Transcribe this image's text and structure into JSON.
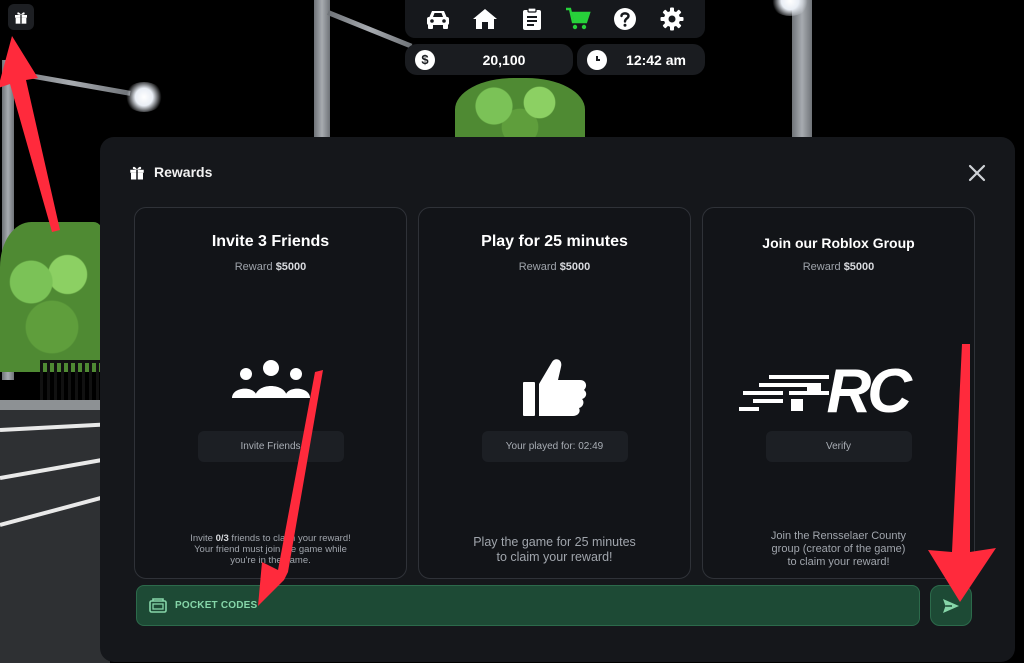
{
  "hud": {
    "gift_icon": "gift-icon",
    "toolbar_icons": [
      "car-icon",
      "home-icon",
      "clipboard-icon",
      "cart-icon",
      "help-icon",
      "settings-icon"
    ],
    "money_value": "20,100",
    "money_symbol": "$",
    "time_value": "12:42 am"
  },
  "modal": {
    "title": "Rewards",
    "cards": [
      {
        "title": "Invite 3 Friends",
        "reward_prefix": "Reward",
        "reward_amount": "$5000",
        "button_label": "Invite Friends",
        "desc_line1_pre": "Invite ",
        "desc_count": "0/3",
        "desc_line1_post": " friends to claim your reward!",
        "desc_line2": "Your friend must join the game while",
        "desc_line3": "you're in the game."
      },
      {
        "title": "Play for 25 minutes",
        "reward_prefix": "Reward",
        "reward_amount": "$5000",
        "button_label": "Your played for: 02:49",
        "desc_line1": "Play the game for 25 minutes",
        "desc_line2": "to claim your reward!"
      },
      {
        "title": "Join our Roblox Group",
        "reward_prefix": "Reward",
        "reward_amount": "$5000",
        "logo_text": "RC",
        "button_label": "Verify",
        "desc_line1": "Join the Rensselaer County",
        "desc_line2": "group (creator of the game)",
        "desc_line3": "to claim your reward!"
      }
    ],
    "code_input": {
      "placeholder": "POCKET CODES",
      "value": ""
    }
  },
  "colors": {
    "accent_green": "#1d4a35",
    "cart_green": "#27d13a",
    "arrow_red": "#ff2a3c"
  }
}
